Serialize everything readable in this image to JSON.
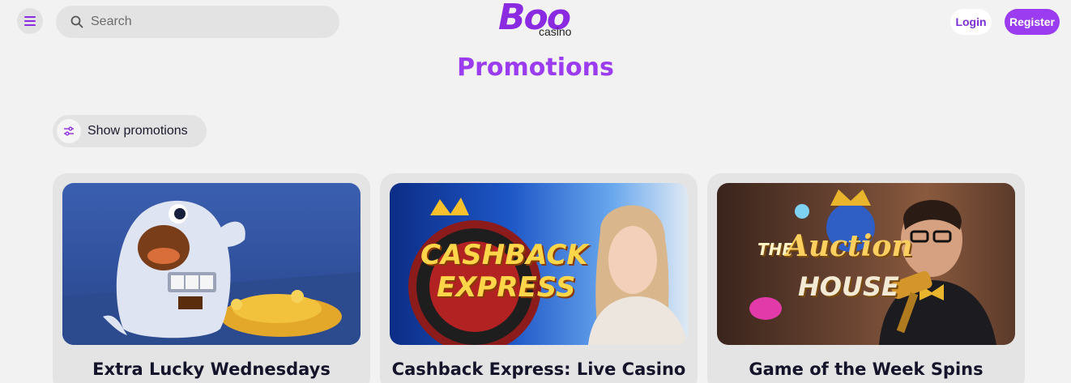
{
  "header": {
    "search_placeholder": "Search",
    "logo_main": "Boo",
    "logo_sub": "casino",
    "login_label": "Login",
    "register_label": "Register"
  },
  "page": {
    "title": "Promotions",
    "filter_label": "Show promotions"
  },
  "promotions": [
    {
      "title": "Extra Lucky Wednesdays"
    },
    {
      "title": "Cashback Express: Live Casino",
      "image_text_1": "CASHBACK",
      "image_text_2": "EXPRESS"
    },
    {
      "title": "Game of the Week Spins",
      "image_text_1": "THE",
      "image_text_2": "Auction",
      "image_text_3": "HOUSE"
    }
  ],
  "colors": {
    "accent": "#9b3cf0",
    "background": "#f2f2f2",
    "card": "#e4e4e4"
  }
}
